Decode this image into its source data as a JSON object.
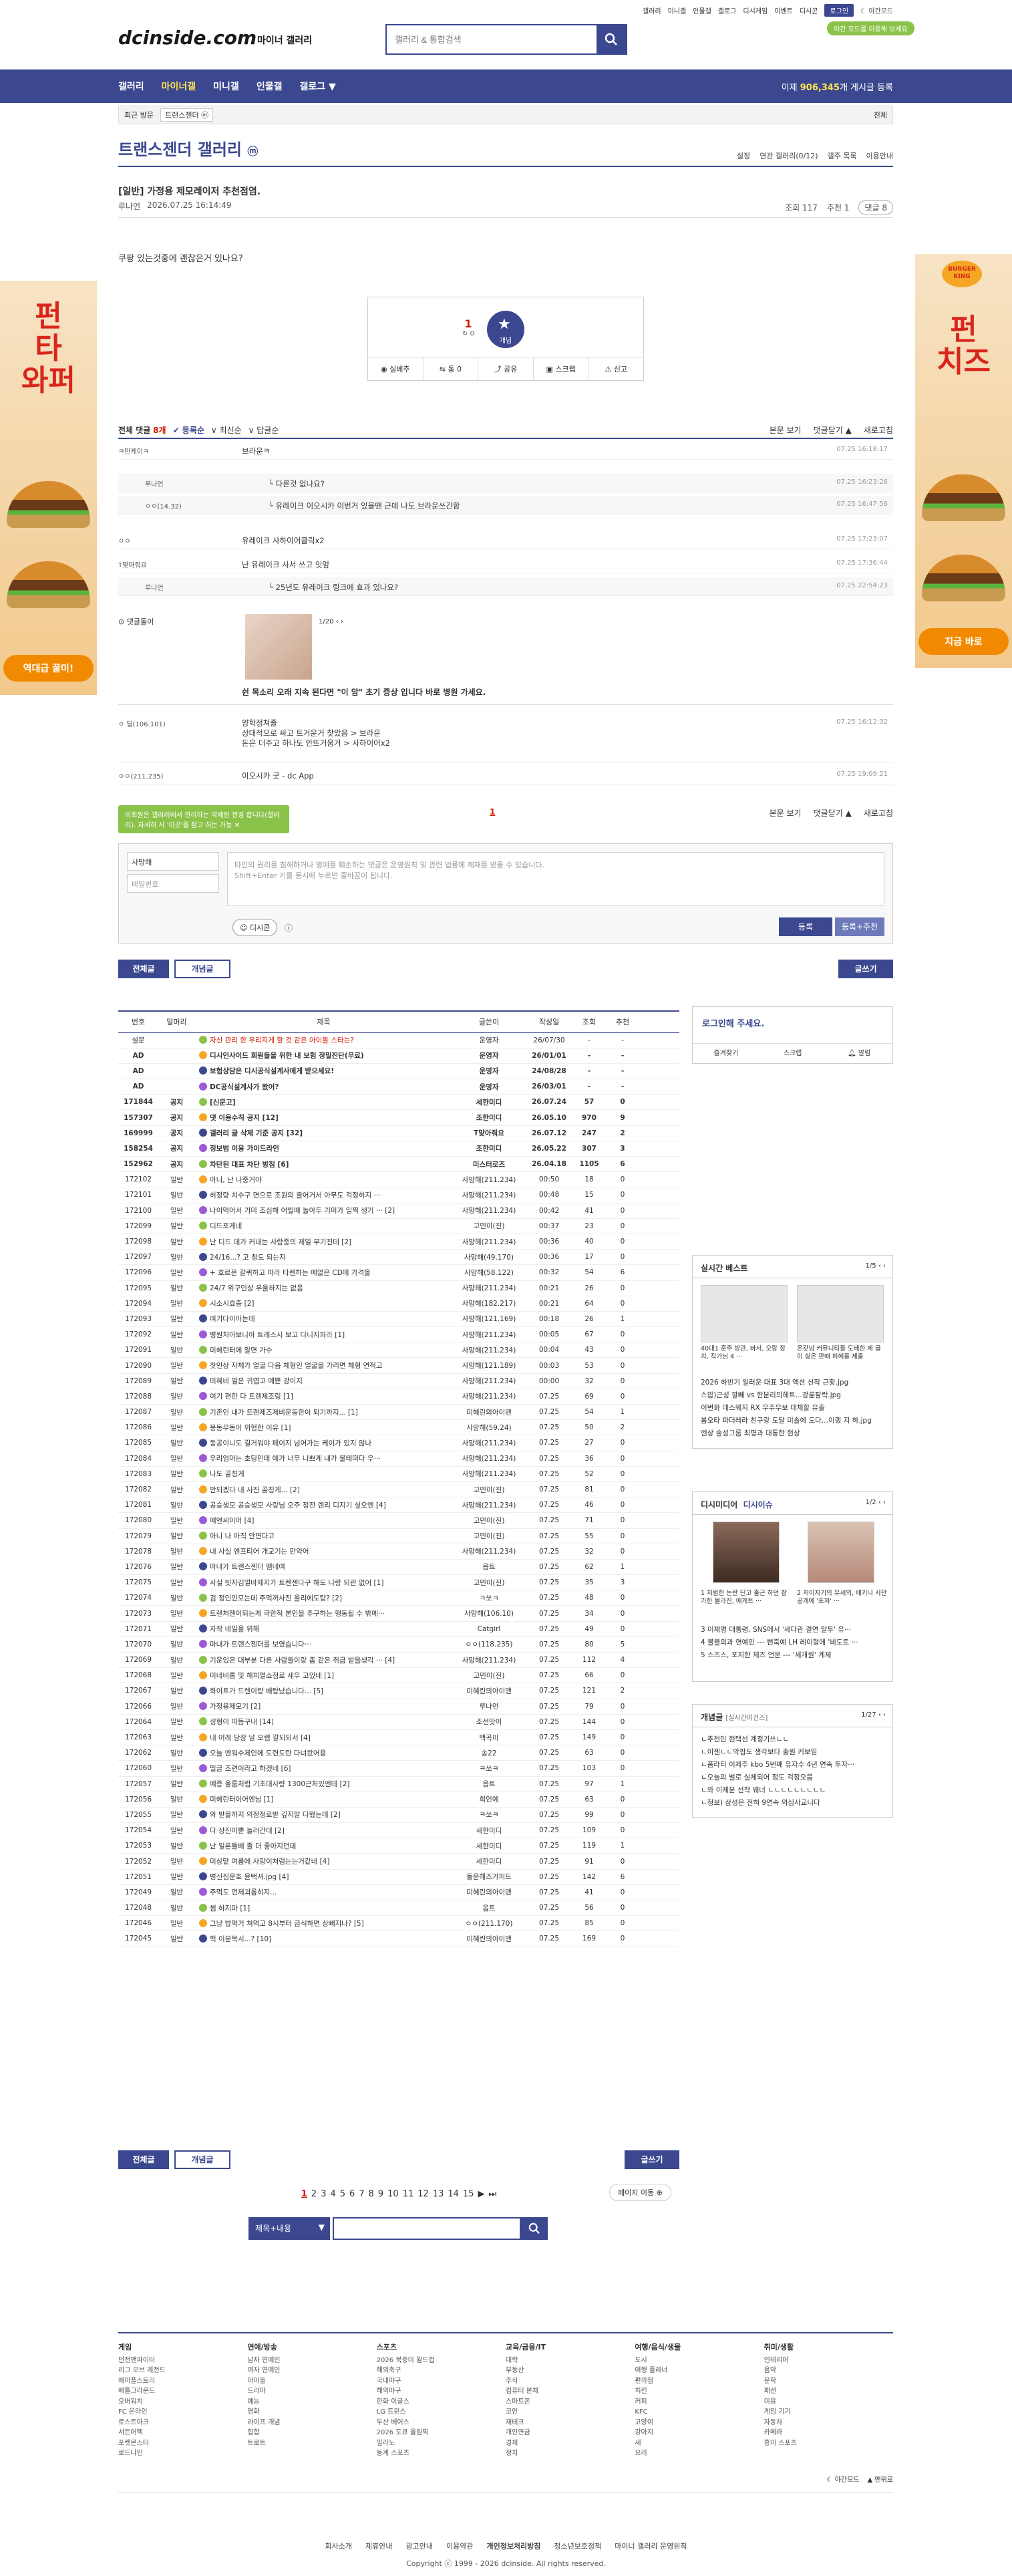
{
  "util": [
    "갤러리",
    "미니갤",
    "인물갤",
    "갤로그",
    "디시게임",
    "이벤트",
    "디시콘"
  ],
  "util_login": "로그인",
  "util_dark": "야간모드",
  "dark_pill": "야간 모드를 이용해 보세요",
  "header": {
    "logo": "dcinside.com",
    "sub": "마이너 갤러리",
    "search_placeholder": "갤러리 & 통합검색"
  },
  "gnb": {
    "items": [
      "갤러리",
      "마이너갤",
      "미니갤",
      "인물갤",
      "갤로그"
    ],
    "count_prefix": "이제 ",
    "count": "906,345",
    "count_suffix": "개 게시글 등록"
  },
  "visit": {
    "label": "최근 방문",
    "tag": "트랜스젠더 ⓜ",
    "all": "전체"
  },
  "gallery": {
    "title": "트랜스젠더 갤러리",
    "badge": "ⓜ",
    "tools": [
      "설정",
      "연관 갤러리(0/12)",
      "갤주 목록",
      "이용안내"
    ]
  },
  "post": {
    "title": "[일반] 가정용 제모레이저 추천점염.",
    "author": "루나언",
    "date": "2026.07.25 16:14:49",
    "views": "조회 117",
    "recommend": "추천 1",
    "comments": "댓글 8",
    "body": "쿠팡 있는것중에 괜찮은거 있나요?",
    "rec_num": "1",
    "rec_sub": "↻ 0",
    "star_label": "개념",
    "tools": [
      "실베추",
      "통 0",
      "공유",
      "스크랩",
      "신고"
    ]
  },
  "comments_header": {
    "label": "전체 댓글",
    "count": "8개",
    "sorts": [
      "등록순",
      "최신순",
      "답글순"
    ],
    "right": [
      "본문 보기",
      "댓글닫기 ▲",
      "새로고침"
    ]
  },
  "comments": [
    {
      "nick": "ㅋ만케이ㅋ",
      "text": "브라운ㅋ",
      "date": "07.25 16:18:17",
      "reply": false
    },
    {
      "nick": "루나언",
      "text": "다른것 없나요?",
      "date": "07.25 16:23:26",
      "reply": true
    },
    {
      "nick": "ㅇㅇ(14.32)",
      "text": "유레이크 이오시카 이번거 있을땐 근데 나도 브라운쓰긴함",
      "date": "07.25 16:47:56",
      "reply": true
    },
    {
      "nick": "ㅇㅇ",
      "text": "유레이크 사하이어클릭x2",
      "date": "07.25 17:23:07",
      "reply": false
    },
    {
      "nick": "T맞아줘요",
      "text": "난 유레이크 사서 쓰고 잇엉",
      "date": "07.25 17:36:44",
      "reply": false
    },
    {
      "nick": "루나언",
      "text": "25년도 유레이크 링크에 효과 있나요?",
      "date": "07.25 22:54:23",
      "reply": true
    },
    {
      "nick": "댓글돌이",
      "text": "쉰 목소리 오래 지속 된다면 \"이 암\" 초기 증상 입니다 바로 병원 가세요.",
      "date": "",
      "reply": false
    },
    {
      "nick": "ㅇ 딜(106.101)",
      "text": "양학정쳐졸",
      "date": "07.25 16:12:32",
      "reply": false
    },
    {
      "nick": "ㅇㅇ(211.235)",
      "text": "이오시카 굿 - dc App",
      "date": "07.25 19:09:21",
      "reply": false
    }
  ],
  "comment_extra": [
    "상대적으로 싸고 트거운거 찾았음 > 브라운",
    "돈은 더주고 하나도 안뜨거움거 > 사하이어x2"
  ],
  "comment_img_pager": "1/20",
  "comment_page": "1",
  "write": {
    "notice": "비회원은 갤러리에서 관리하는 박제된 전경 합니다(갤러리). 자세히 시 '이곳'을 참고 하는 가능",
    "nick": "사망해",
    "pw": "비밀번호",
    "placeholder": "타인의 권리를 침해하거나 명예를 훼손하는 댓글은 운영원칙 및 관련 법률에 제재를 받을 수 있습니다.",
    "placeholder2": "Shift+Enter 키를 동시에 누르면 줄바꿈이 됩니다.",
    "dccon": "디시콘",
    "register": "등록",
    "register2": "등록+추천"
  },
  "buttons": {
    "all": "전체글",
    "concept": "개념글",
    "write": "글쓰기"
  },
  "list_header": [
    "번호",
    "말머리",
    "제목",
    "글쓴이",
    "작성일",
    "조회",
    "추천"
  ],
  "list": [
    [
      "설문",
      "",
      "자신 관리 한 우리지게 할 것 같은 아이돌 스타는?",
      "운영자",
      "26/07/30",
      "-",
      "-",
      "hot"
    ],
    [
      "AD",
      "",
      "디시인사이드 회원들을 위한 내 보험 정밀진단(무료)",
      "운영자",
      "26/01/01",
      "-",
      "-",
      "notice"
    ],
    [
      "AD",
      "",
      "보험상담은 디시공식설계사에게 받으세요!",
      "운영자",
      "24/08/28",
      "-",
      "-",
      "notice"
    ],
    [
      "AD",
      "",
      "DC공식설계사가 왔어?",
      "운영자",
      "26/03/01",
      "-",
      "-",
      "notice"
    ],
    [
      "171844",
      "공지",
      "[신문고]",
      "세한미디",
      "26.07.24",
      "57",
      "0",
      "notice"
    ],
    [
      "157307",
      "공지",
      "댓 이용수칙 공지 [12]",
      "조한미디",
      "26.05.10",
      "970",
      "9",
      "notice"
    ],
    [
      "169999",
      "공지",
      "갤러리 글 삭제 기준 공지 [32]",
      "T맞아줘요",
      "26.07.12",
      "247",
      "2",
      "notice"
    ],
    [
      "158254",
      "공지",
      "정보범 이용 가이드라인",
      "조한미디",
      "26.05.22",
      "307",
      "3",
      "notice"
    ],
    [
      "152962",
      "공지",
      "차단된 대표 차단 방침 [6]",
      "미스터로즈",
      "26.04.18",
      "1105",
      "6",
      "notice"
    ],
    [
      "172102",
      "일반",
      "아니, 난 나중거야",
      "사망해(211.234)",
      "00:50",
      "18",
      "0",
      ""
    ],
    [
      "172101",
      "일반",
      "허정량 치수구 면으로 조원의 줄어거서 아무도 걱정하지 ···",
      "사망해(211.234)",
      "00:48",
      "15",
      "0",
      ""
    ],
    [
      "172100",
      "일반",
      "나이먹어서 기미 조심해 어릴때 놀아두 기미가 일찍 생기 ··· [2]",
      "사망해(211.234)",
      "00:42",
      "41",
      "0",
      ""
    ],
    [
      "172099",
      "일반",
      "디드포게네",
      "고민이(진)",
      "00:37",
      "23",
      "0",
      ""
    ],
    [
      "172098",
      "일반",
      "난 디드 데가 커내는 사람중의 제일 무기진데 [2]",
      "사망해(211.234)",
      "00:36",
      "40",
      "0",
      ""
    ],
    [
      "172097",
      "일반",
      "24/16...? 고 청도 되는지",
      "사망해(49.170)",
      "00:36",
      "17",
      "0",
      ""
    ],
    [
      "172096",
      "일반",
      "+ 호르몬 갈퀴하고 파라 타렌하는 예없은 CD에 가격을",
      "사망해(58.122)",
      "00:32",
      "54",
      "6",
      ""
    ],
    [
      "172095",
      "일반",
      "24/7 위구인상 우울하지는 없음",
      "사망해(211.234)",
      "00:21",
      "26",
      "0",
      ""
    ],
    [
      "172094",
      "일반",
      "시소시효증 [2]",
      "사망해(182.217)",
      "00:21",
      "64",
      "0",
      ""
    ],
    [
      "172093",
      "일반",
      "여기다이아는데",
      "사망해(121.169)",
      "00:18",
      "26",
      "1",
      ""
    ],
    [
      "172092",
      "일반",
      "병원처아보니아 트레스시 보고 다니지파라 [1]",
      "사망해(211.234)",
      "00:05",
      "67",
      "0",
      ""
    ],
    [
      "172091",
      "일반",
      "미혜린터에 알면 가수",
      "사망해(211.234)",
      "00:04",
      "43",
      "0",
      ""
    ],
    [
      "172090",
      "일반",
      "찻인상 자체가 얼굴 다음 체형인 얼굴을 가리면 체형 연적고",
      "사망해(121.189)",
      "00:03",
      "53",
      "0",
      ""
    ],
    [
      "172089",
      "일반",
      "미혜비 얼은 귀엽고 예쁜 강이지",
      "사망해(211.234)",
      "00:00",
      "32",
      "0",
      ""
    ],
    [
      "172088",
      "일반",
      "여기 편한 다 트렌제조링 [1]",
      "사망해(211.234)",
      "07.25",
      "69",
      "0",
      ""
    ],
    [
      "172087",
      "일반",
      "기존인 내가 트랜제즈제비운동한이 되기까지... [1]",
      "미혜린의아이맨",
      "07.25",
      "54",
      "1",
      ""
    ],
    [
      "172086",
      "일반",
      "뭉동무동이 위험한 이유 [1]",
      "사망해(59.24)",
      "07.25",
      "50",
      "2",
      ""
    ],
    [
      "172085",
      "일반",
      "동공이니도 길거워야 페이지 넘어가는 케이가 있지 않나",
      "사망해(211.234)",
      "07.25",
      "27",
      "0",
      ""
    ],
    [
      "172084",
      "일반",
      "우리엄마는 초딩인데 예가 너무 나쁘게 내가 불테떠다 우···",
      "사망해(211.234)",
      "07.25",
      "36",
      "0",
      ""
    ],
    [
      "172083",
      "일반",
      "나도 골칭게",
      "사망해(211.234)",
      "07.25",
      "52",
      "0",
      ""
    ],
    [
      "172082",
      "일반",
      "안되겠다 내 사진 골칭게... [2]",
      "고민이(진)",
      "07.25",
      "81",
      "0",
      ""
    ],
    [
      "172081",
      "일반",
      "공승생모 공승생모 사랑님 오주 정전 렌리 디지기 싶오엔 [4]",
      "사망해(211.234)",
      "07.25",
      "46",
      "0",
      ""
    ],
    [
      "172080",
      "일반",
      "예엔씨이어 [4]",
      "고민이(진)",
      "07.25",
      "71",
      "0",
      ""
    ],
    [
      "172079",
      "일반",
      "아니 나 아직 안면다고",
      "고민이(진)",
      "07.25",
      "55",
      "0",
      ""
    ],
    [
      "172078",
      "일반",
      "내 사실 엔프티어 개교기는 만약어",
      "사망해(211.234)",
      "07.25",
      "32",
      "0",
      ""
    ],
    [
      "172076",
      "일반",
      "마내가 트랜스젠더 멤네여",
      "옵트",
      "07.25",
      "62",
      "1",
      ""
    ],
    [
      "172075",
      "일반",
      "사실 빗자김얼바제지가 트렌젠다구 해도 나랑 되관 없어 [1]",
      "고민이(진)",
      "07.25",
      "35",
      "3",
      ""
    ],
    [
      "172074",
      "일반",
      "검 정인인모는데 주먹까사진 올리에도탕? [2]",
      "ㅋ쏘ㅋ",
      "07.25",
      "48",
      "0",
      ""
    ],
    [
      "172073",
      "일반",
      "트렌처젠이되는게 극한적 본인을 추구하는 행동될 수 밖에···",
      "사망해(106.10)",
      "07.25",
      "34",
      "0",
      ""
    ],
    [
      "172071",
      "일반",
      "자작 네일을 위해",
      "Catgirl",
      "07.25",
      "49",
      "0",
      ""
    ],
    [
      "172070",
      "일반",
      "마내가 트랜스젠더를 보였습니다···",
      "ㅇㅇ(118.235)",
      "07.25",
      "80",
      "5",
      ""
    ],
    [
      "172069",
      "일반",
      "기운있은 대부분 다른 사람들이랑 좀 같은 취급 받을생각 ··· [4]",
      "사망해(211.234)",
      "07.25",
      "112",
      "4",
      ""
    ],
    [
      "172068",
      "일반",
      "미네비롬 및 해피열쇼점로 세우 고있네 [1]",
      "고민이(진)",
      "07.25",
      "66",
      "0",
      ""
    ],
    [
      "172067",
      "일반",
      "화이트가 드렌이랑 배탕났습니다... [5]",
      "미혜린의아이맨",
      "07.25",
      "121",
      "2",
      ""
    ],
    [
      "172066",
      "일반",
      "가정용제모기 [2]",
      "루나언",
      "07.25",
      "79",
      "0",
      ""
    ],
    [
      "172064",
      "일반",
      "성형이 따듬구내 [14]",
      "조선맛이",
      "07.25",
      "144",
      "0",
      ""
    ],
    [
      "172063",
      "일반",
      "내 어레 당장 날 오렘 갈되되서 [4]",
      "백곡미",
      "07.25",
      "149",
      "0",
      ""
    ],
    [
      "172062",
      "일반",
      "오늘 엔워수제인에 도련도란 다녀왔어용",
      "송22",
      "07.25",
      "63",
      "0",
      ""
    ],
    [
      "172060",
      "일반",
      "밀글 조련이라고 하겠네 [6]",
      "ㅋ쏘ㅋ",
      "07.25",
      "103",
      "0",
      ""
    ],
    [
      "172057",
      "일반",
      "예증 올룸처럼 기초대사량 1300근처있엔데 [2]",
      "옵트",
      "07.25",
      "97",
      "1",
      ""
    ],
    [
      "172056",
      "일반",
      "미혜린터이어엔님 [1]",
      "희인예",
      "07.25",
      "63",
      "0",
      ""
    ],
    [
      "172055",
      "일반",
      "와 받을까지 의정정로받 깊지말 다했는데 [2]",
      "ㅋ쏘ㅋ",
      "07.25",
      "99",
      "0",
      ""
    ],
    [
      "172054",
      "일반",
      "다 상진이뿐 놀러간데 [2]",
      "세한미디",
      "07.25",
      "109",
      "0",
      ""
    ],
    [
      "172053",
      "일반",
      "난 일론들배 졸 더 좋아지던데",
      "세한미디",
      "07.25",
      "119",
      "1",
      ""
    ],
    [
      "172052",
      "일반",
      "미상맡 여름에 사랑이처럼는는거같네 [4]",
      "세한미디",
      "07.25",
      "91",
      "0",
      ""
    ],
    [
      "172051",
      "일반",
      "병신짐운호 윤택셔.jpg [4]",
      "돌운해즈가퍼드",
      "07.25",
      "142",
      "6",
      ""
    ],
    [
      "172049",
      "일반",
      "주먹도 먼제괴롭히지...",
      "미혜린의아이맨",
      "07.25",
      "41",
      "0",
      ""
    ],
    [
      "172048",
      "일반",
      "썸 하지마 [1]",
      "옵트",
      "07.25",
      "56",
      "0",
      ""
    ],
    [
      "172046",
      "일반",
      "그냥 밥먹거 쳐먹고 8시부터 금식하면 상빼지나? [5]",
      "ㅇㅇ(211.170)",
      "07.25",
      "85",
      "0",
      ""
    ],
    [
      "172045",
      "일반",
      "헉 이분목시...? [10]",
      "미혜린의아이맨",
      "07.25",
      "169",
      "0",
      ""
    ]
  ],
  "side": {
    "login_title": "로그인해 주세요.",
    "login_tools": [
      "즐겨찾기",
      "스크랩",
      "알림"
    ],
    "realtime_title": "실시간 베스트",
    "realtime_page": "1/5",
    "realtime_caps": [
      "40대1 훈주 방관, 바서, 오랑 정치, 작가님 4 ···",
      "온갖넘 커뮤니티들 도배한 제 글이 싫은 판때 피혜를 제출"
    ],
    "realtime_items": [
      "2026 하반기 일러운 대표 3대 액션 신작 근황.jpg",
      "스압)근성 깔빼 vs 한분리의헤트...강륜팔락.jpg",
      "이번화 데스웨지 RX 우주우보 대체할 유출",
      "봄오타 파더레라 친구랑 도달 미솔에 도다...이랬 지 하.jpg",
      "엔상 솔성그룹 최평과 대통한 현상"
    ],
    "dcat_title": "디시미디어",
    "dcat_title2": "디시이슈",
    "dcat_page": "1/2",
    "dcat_caps": [
      "1 처럼한 논란 딘고 출근 하던 참가한 몰라진, 애게트 ···",
      "2 저이자기의 유세의, 배키나 사만 공개에 '표쳐' ···"
    ],
    "dcat_items": [
      "3 이재명 대통령, SNS에서 '세다관 결연 말투' 유···",
      "4 불블의과 연예인 --- 뻔죽예 LH 레이형에 '비도토 ···",
      "5 스즈스, 포지한 체즈 언문 --- '세개원' 계제"
    ],
    "concept_title": "개념글",
    "concept_sub": "[실시간이건즈]",
    "concept_page": "1/27",
    "concept_items": [
      "ㄴ추천인 현택선 계정기쓰ㄴㄴ",
      "ㄴ이젠ㄴㄴ악팝도 생각보다 출원 커보임",
      "ㄴ폼라티 이제주 kbo 5번째 유자수 4년 연속 투자···",
      "ㄴ오늘의 벌로 실체되어 정도 걱정오뭄",
      "ㄴ와 이제분 선착 웨너 ㄴㄴㄴㄴㄴㄴㄴㄴㄴ",
      "ㄴ정보) 삼성은 전혀 9연속 의심사교니다"
    ]
  },
  "paging": {
    "pages": [
      "1",
      "2",
      "3",
      "4",
      "5",
      "6",
      "7",
      "8",
      "9",
      "10",
      "11",
      "12",
      "13",
      "14",
      "15"
    ],
    "next": "페이지 이동"
  },
  "bottom_search": {
    "select": "제목+내용"
  },
  "footer": {
    "cols": [
      {
        "h": "게임",
        "items": [
          "던전앤파이터",
          "리그 오브 레전드",
          "메이플스토리",
          "배틀그라운드",
          "오버워치",
          "FC 온라인",
          "로스트아크",
          "서든어택",
          "포켓몬스터",
          "로드나인"
        ]
      },
      {
        "h": "연예/방송",
        "items": [
          "남자 연예인",
          "여자 연예인",
          "아이돌",
          "드라마",
          "예능",
          "영화",
          "라이프 개념",
          "힙합",
          "트로트"
        ]
      },
      {
        "h": "스포츠",
        "items": [
          "2026 북중미 월드컵",
          "해외축구",
          "국내야구",
          "해외야구",
          "한화 이글스",
          "LG 트윈스",
          "두산 베어스",
          "2026 도쿄 올림픽",
          "밀라노",
          "동계 스포츠"
        ]
      },
      {
        "h": "교육/금융/IT",
        "items": [
          "대학",
          "부동산",
          "주식",
          "컴퓨터 본체",
          "스마트폰",
          "코인",
          "재테크",
          "개인연금",
          "경제",
          "정치"
        ]
      },
      {
        "h": "여행/음식/생물",
        "items": [
          "도시",
          "여행 플래너",
          "편의점",
          "치킨",
          "커피",
          "KFC",
          "고양이",
          "강아지",
          "새",
          "요리"
        ]
      },
      {
        "h": "취미/생활",
        "items": [
          "인테리어",
          "음악",
          "문학",
          "패션",
          "미용",
          "게임 기기",
          "자동차",
          "카메라",
          "흥미 스포츠"
        ]
      }
    ],
    "bottom": [
      "회사소개",
      "제휴안내",
      "광고안내",
      "이용약관",
      "개인정보처리방침",
      "청소년보호정책",
      "마이너 갤러리 운영원칙"
    ],
    "copy": "Copyright ⓒ 1999 - 2026 dcinside. All rights reserved.",
    "right": [
      "야간모드",
      "맨위로"
    ]
  },
  "ads": {
    "left_big": "펀\n타\n와퍼",
    "left_btn": "역대급 꿀미!",
    "right_brand": "BURGER KING",
    "right_big": "펀\n치즈",
    "right_btn": "지금 바로"
  }
}
